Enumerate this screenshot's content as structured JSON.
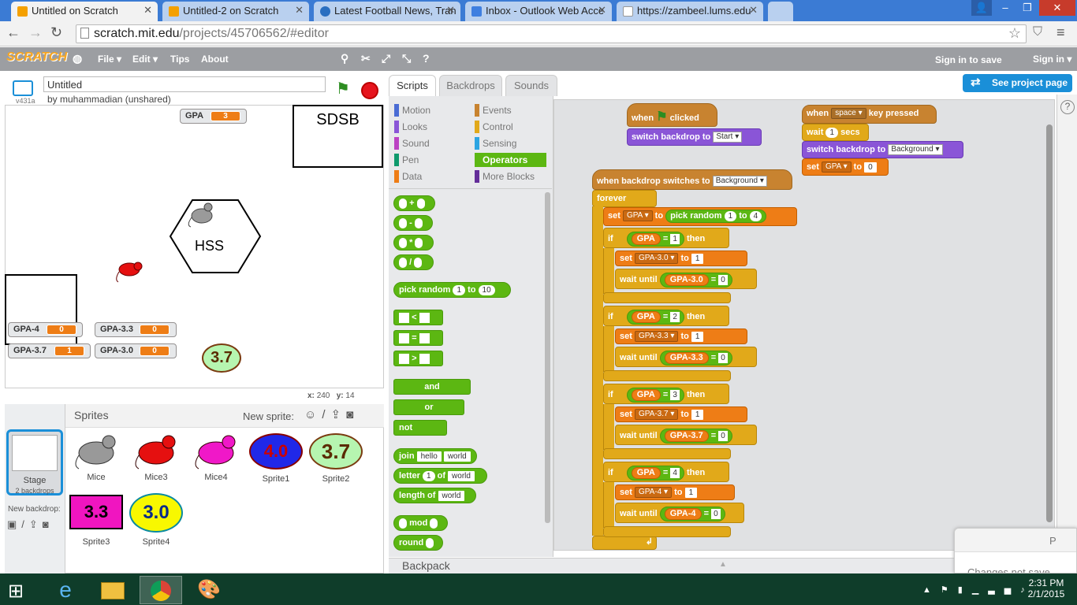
{
  "browser": {
    "tabs": [
      {
        "title": "Untitled on Scratch",
        "active": true
      },
      {
        "title": "Untitled-2 on Scratch"
      },
      {
        "title": "Latest Football News, Tran"
      },
      {
        "title": "Inbox - Outlook Web Acce"
      },
      {
        "title": "https://zambeel.lums.edu"
      }
    ],
    "url_host": "scratch.mit.edu",
    "url_path": "/projects/45706562/#editor"
  },
  "scratch": {
    "logo": "SCRATCH",
    "menu": [
      "File ▾",
      "Edit ▾",
      "Tips",
      "About"
    ],
    "signin_save": "Sign in to save",
    "signin": "Sign in ▾",
    "see_project": "See project page",
    "project_title": "Untitled",
    "author": "by muhammadian (unshared)",
    "version": "v431a",
    "coords": {
      "x_label": "x:",
      "x": "240",
      "y_label": "y:",
      "y": "14"
    },
    "tabs": [
      "Scripts",
      "Backdrops",
      "Sounds"
    ],
    "categories_left": [
      "Motion",
      "Looks",
      "Sound",
      "Pen",
      "Data"
    ],
    "categories_right": [
      "Events",
      "Control",
      "Sensing",
      "Operators",
      "More Blocks"
    ],
    "palette": {
      "plus": "+",
      "minus": "-",
      "times": "*",
      "div": "/",
      "pick_random": "pick random",
      "pr_from": "1",
      "pr_to_label": "to",
      "pr_to": "10",
      "lt": "<",
      "eq": "=",
      "gt": ">",
      "and": "and",
      "or": "or",
      "not": "not",
      "join": "join",
      "join_a": "hello",
      "join_b": "world",
      "letter": "letter",
      "letter_n": "1",
      "letter_of": "of",
      "letter_w": "world",
      "length": "length of",
      "length_w": "world",
      "mod": "mod",
      "round": "round"
    },
    "backpack": "Backpack",
    "stage": {
      "monitors": [
        {
          "label": "GPA",
          "value": "3"
        },
        {
          "label": "GPA-4",
          "value": "0"
        },
        {
          "label": "GPA-3.3",
          "value": "0"
        },
        {
          "label": "GPA-3.7",
          "value": "1"
        },
        {
          "label": "GPA-3.0",
          "value": "0"
        }
      ],
      "sdsb": "SDSB",
      "hss": "HSS",
      "bubble": "3.7"
    },
    "sprites_header": "Sprites",
    "new_sprite": "New sprite:",
    "stage_thumb": {
      "label": "Stage",
      "sub": "2 backdrops"
    },
    "new_backdrop": "New backdrop:",
    "sprites": [
      {
        "name": "Mice"
      },
      {
        "name": "Mice3"
      },
      {
        "name": "Mice4"
      },
      {
        "name": "Sprite1",
        "text": "4.0"
      },
      {
        "name": "Sprite2",
        "text": "3.7"
      },
      {
        "name": "Sprite3",
        "text": "3.3"
      },
      {
        "name": "Sprite4",
        "text": "3.0"
      }
    ],
    "script": {
      "when": "when",
      "clicked": "clicked",
      "switch_backdrop": "switch backdrop to",
      "start": "Start",
      "when_space": "when",
      "space": "space",
      "key_pressed": "key pressed",
      "wait": "wait",
      "wait_n": "1",
      "secs": "secs",
      "background": "Background",
      "set": "set",
      "gpa": "GPA",
      "to": "to",
      "zero": "0",
      "when_backdrop": "when backdrop switches to",
      "forever": "forever",
      "pick_random": "pick random",
      "one": "1",
      "four": "4",
      "if": "if",
      "then": "then",
      "eq": "=",
      "wait_until": "wait until",
      "ifs": [
        {
          "n": "1",
          "var": "GPA-3.0"
        },
        {
          "n": "2",
          "var": "GPA-3.3"
        },
        {
          "n": "3",
          "var": "GPA-3.7"
        },
        {
          "n": "4",
          "var": "GPA-4"
        }
      ]
    },
    "dialog_text": "Changes not save",
    "dialog_p": "P"
  },
  "taskbar": {
    "time": "2:31 PM",
    "date": "2/1/2015"
  }
}
